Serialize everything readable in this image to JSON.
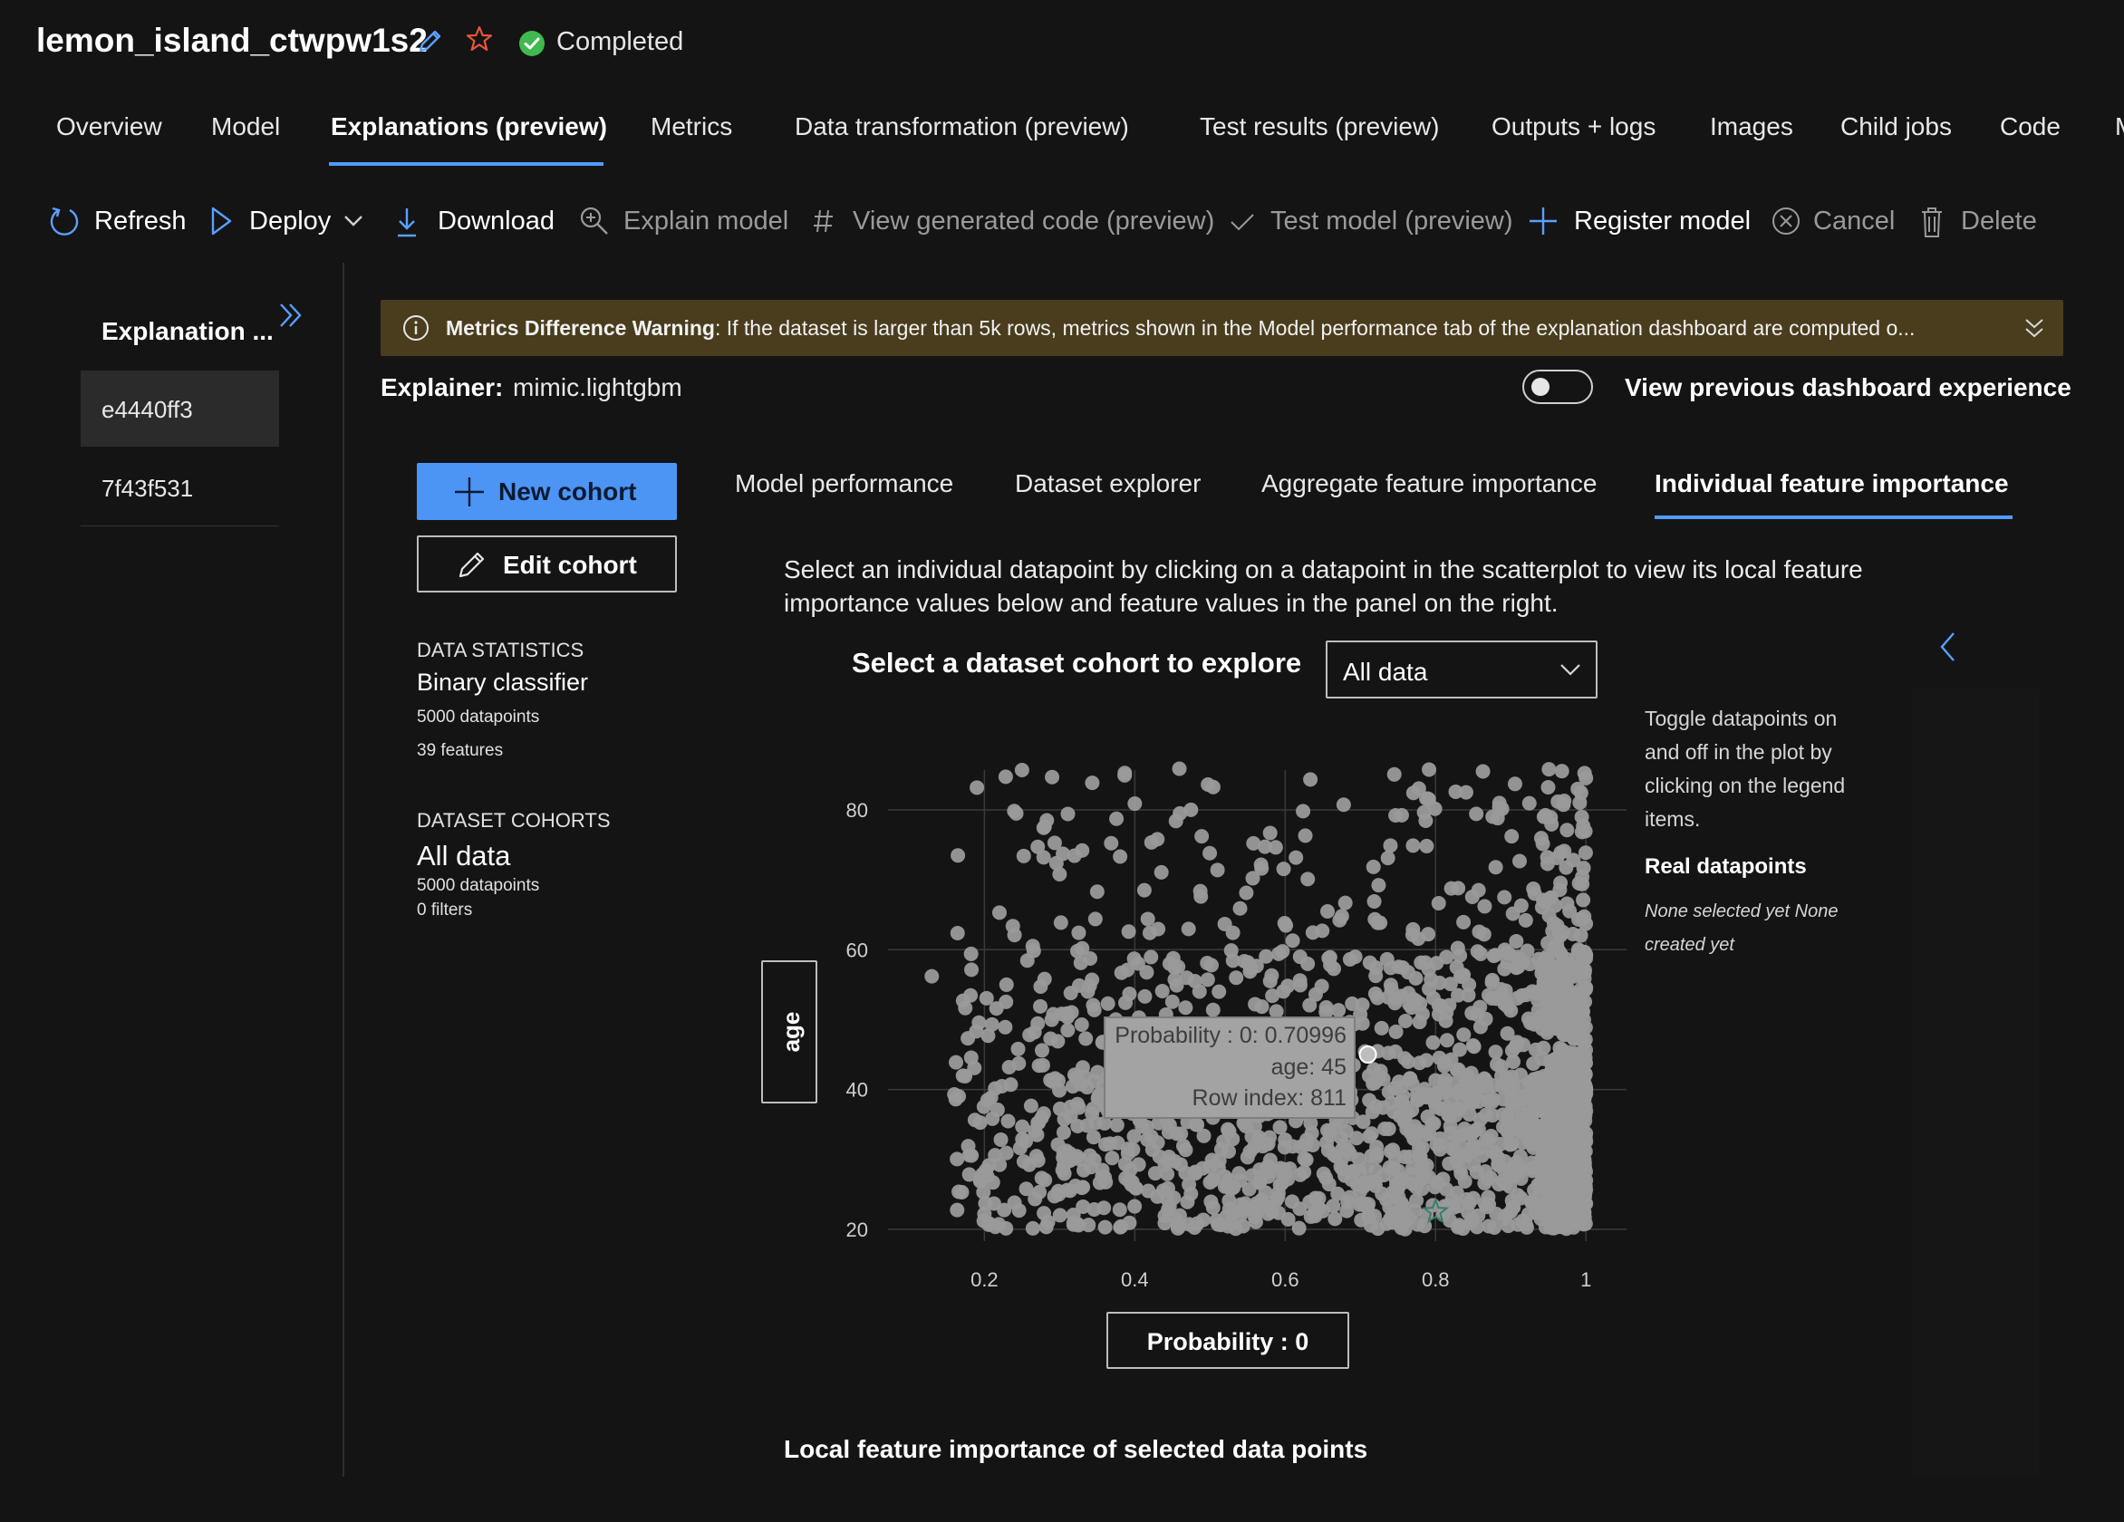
{
  "job": {
    "title": "lemon_island_ctwpw1s2",
    "status": "Completed"
  },
  "tabs": [
    "Overview",
    "Model",
    "Explanations (preview)",
    "Metrics",
    "Data transformation (preview)",
    "Test results (preview)",
    "Outputs + logs",
    "Images",
    "Child jobs",
    "Code",
    "M"
  ],
  "active_tab": "Explanations (preview)",
  "toolbar": {
    "refresh": "Refresh",
    "deploy": "Deploy",
    "download": "Download",
    "explain_model": "Explain model",
    "view_code": "View generated code (preview)",
    "test_model": "Test model (preview)",
    "register_model": "Register model",
    "cancel": "Cancel",
    "delete": "Delete"
  },
  "explanations_pane": {
    "header": "Explanation ...",
    "items": [
      "e4440ff3",
      "7f43f531"
    ]
  },
  "warning": {
    "title": "Metrics Difference Warning",
    "text": ": If the dataset is larger than 5k rows, metrics shown in the Model performance tab of the explanation dashboard are computed o..."
  },
  "explainer": {
    "label": "Explainer:",
    "value": "mimic.lightgbm"
  },
  "previous_experience": {
    "label": "View previous dashboard experience",
    "enabled": false
  },
  "cohort_buttons": {
    "new": "New cohort",
    "edit": "Edit cohort"
  },
  "data_statistics": {
    "heading": "DATA STATISTICS",
    "type": "Binary classifier",
    "datapoints": "5000 datapoints",
    "features": "39 features"
  },
  "dataset_cohorts": {
    "heading": "DATASET COHORTS",
    "name": "All data",
    "datapoints": "5000 datapoints",
    "filters": "0 filters"
  },
  "inner_tabs": [
    "Model performance",
    "Dataset explorer",
    "Aggregate feature importance",
    "Individual feature importance"
  ],
  "active_inner_tab": "Individual feature importance",
  "instructions": "Select an individual datapoint by clicking on a datapoint in the scatterplot to view its local feature importance values below and feature values in the panel on the right.",
  "cohort_select": {
    "label": "Select a dataset cohort to explore",
    "value": "All data"
  },
  "legend": {
    "hint": "Toggle datapoints on and off in the plot by clicking on the legend items.",
    "title": "Real datapoints",
    "status": "None selected yet  None created yet"
  },
  "tooltip": {
    "line1": "Probability : 0: 0.70996",
    "line2": "age: 45",
    "line3": "Row index: 811"
  },
  "local_fi_title": "Local feature importance of selected data points",
  "colors": {
    "accent": "#4f9bff",
    "warning_bg": "#4a3d1e",
    "point": "#9a9a9a",
    "success": "#3fb950",
    "star": "#e8563a"
  },
  "chart_data": {
    "type": "scatter",
    "xlabel": "Probability : 0",
    "ylabel": "age",
    "xlim": [
      0.12,
      1.06
    ],
    "ylim": [
      17,
      87
    ],
    "xticks": [
      0.2,
      0.4,
      0.6,
      0.8,
      1
    ],
    "yticks": [
      20,
      40,
      60,
      80
    ],
    "tick_labels_x": [
      "0.2",
      "0.4",
      "0.6",
      "0.8",
      "1"
    ],
    "tick_labels_y": [
      "20",
      "40",
      "60",
      "80"
    ],
    "grid": true,
    "highlighted_point": {
      "x": 0.71,
      "y": 45,
      "row_index": 811
    },
    "n_points": 5000,
    "sample_points": [
      [
        0.13,
        56.2
      ],
      [
        0.16,
        39.3
      ],
      [
        0.17,
        25.3
      ],
      [
        0.18,
        30.6
      ],
      [
        0.19,
        83.2
      ],
      [
        0.2,
        22.2
      ],
      [
        0.21,
        49.3
      ],
      [
        0.22,
        65.3
      ],
      [
        0.24,
        23.8
      ],
      [
        0.24,
        62.1
      ],
      [
        0.25,
        85.7
      ],
      [
        0.26,
        47.8
      ],
      [
        0.27,
        33.5
      ],
      [
        0.28,
        77.6
      ],
      [
        0.28,
        55.8
      ],
      [
        0.29,
        84.7
      ],
      [
        0.3,
        70.8
      ],
      [
        0.31,
        25.6
      ],
      [
        0.32,
        42.1
      ],
      [
        0.33,
        60.2
      ],
      [
        0.33,
        74.2
      ],
      [
        0.35,
        68.3
      ],
      [
        0.36,
        27.4
      ],
      [
        0.37,
        40.2
      ],
      [
        0.38,
        22.8
      ],
      [
        0.39,
        57.1
      ],
      [
        0.4,
        80.9
      ],
      [
        0.41,
        34.7
      ],
      [
        0.42,
        62.4
      ],
      [
        0.43,
        75.8
      ],
      [
        0.44,
        29.2
      ],
      [
        0.45,
        47.1
      ],
      [
        0.46,
        79.5
      ],
      [
        0.47,
        23.9
      ],
      [
        0.48,
        55.5
      ],
      [
        0.5,
        36.7
      ],
      [
        0.51,
        71.4
      ],
      [
        0.52,
        26.1
      ],
      [
        0.53,
        44.8
      ],
      [
        0.54,
        65.9
      ],
      [
        0.55,
        30.3
      ],
      [
        0.56,
        52.2
      ],
      [
        0.58,
        76.7
      ],
      [
        0.59,
        24.5
      ],
      [
        0.6,
        39.9
      ],
      [
        0.61,
        61.3
      ],
      [
        0.62,
        31.8
      ],
      [
        0.63,
        70.1
      ],
      [
        0.64,
        48.6
      ],
      [
        0.65,
        22.6
      ],
      [
        0.66,
        57.8
      ],
      [
        0.67,
        42.4
      ],
      [
        0.68,
        66.7
      ],
      [
        0.69,
        28.3
      ],
      [
        0.71,
        45.0
      ],
      [
        0.72,
        53.7
      ],
      [
        0.73,
        37.4
      ],
      [
        0.74,
        74.9
      ],
      [
        0.75,
        25.8
      ],
      [
        0.76,
        49.8
      ],
      [
        0.77,
        62.9
      ],
      [
        0.78,
        34.0
      ],
      [
        0.79,
        81.6
      ],
      [
        0.8,
        41.3
      ],
      [
        0.81,
        22.1
      ],
      [
        0.82,
        55.1
      ],
      [
        0.83,
        68.8
      ],
      [
        0.84,
        30.7
      ],
      [
        0.85,
        46.3
      ],
      [
        0.86,
        59.4
      ],
      [
        0.87,
        24.6
      ],
      [
        0.88,
        71.8
      ],
      [
        0.89,
        38.6
      ],
      [
        0.9,
        51.3
      ],
      [
        0.91,
        28.9
      ],
      [
        0.92,
        64.2
      ],
      [
        0.93,
        43.7
      ],
      [
        0.94,
        21.5
      ],
      [
        0.95,
        56.4
      ],
      [
        0.96,
        33.1
      ],
      [
        0.97,
        47.9
      ],
      [
        0.98,
        25.2
      ],
      [
        0.99,
        60.0
      ],
      [
        1.0,
        39.4
      ]
    ]
  }
}
